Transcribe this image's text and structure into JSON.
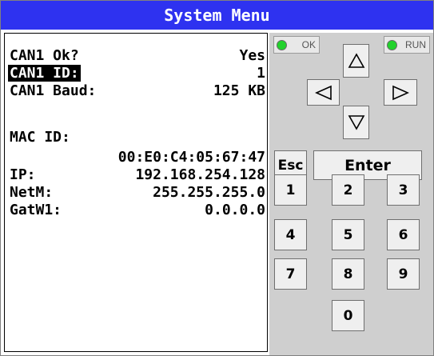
{
  "window": {
    "title": "System Menu"
  },
  "screen": {
    "rows": [
      {
        "label": "CAN1 Ok?",
        "value": "Yes",
        "highlighted": false
      },
      {
        "label": "CAN1 ID:",
        "value": "1",
        "highlighted": true
      },
      {
        "label": "CAN1 Baud:",
        "value": "125 KB",
        "highlighted": false
      },
      {
        "label": "MAC ID:",
        "value": "",
        "highlighted": false
      },
      {
        "label": "",
        "value": "00:E0:C4:05:67:47",
        "highlighted": false
      },
      {
        "label": "IP:",
        "value": "192.168.254.128",
        "highlighted": false
      },
      {
        "label": "NetM:",
        "value": "255.255.255.0",
        "highlighted": false
      },
      {
        "label": "GatW1:",
        "value": "0.0.0.0",
        "highlighted": false
      }
    ]
  },
  "indicators": {
    "ok": {
      "label": "OK",
      "color": "#22d22c"
    },
    "run": {
      "label": "RUN",
      "color": "#22d22c"
    }
  },
  "keypad": {
    "arrows": {
      "up": "up-arrow-icon",
      "down": "down-arrow-icon",
      "left": "left-arrow-icon",
      "right": "right-arrow-icon"
    },
    "esc": "Esc",
    "enter": "Enter",
    "digits": [
      "1",
      "2",
      "3",
      "4",
      "5",
      "6",
      "7",
      "8",
      "9",
      "0"
    ]
  },
  "colors": {
    "title_bar": "#2e32f0",
    "panel": "#cfcfcf",
    "key_face": "#efefef"
  }
}
